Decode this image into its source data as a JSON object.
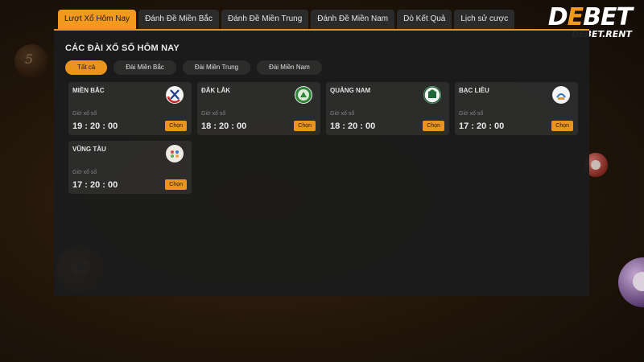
{
  "tabs": [
    {
      "label": "Lượt Xổ Hôm Nay",
      "active": true
    },
    {
      "label": "Đánh Đề Miền Bắc",
      "active": false
    },
    {
      "label": "Đánh Đề Miền Trung",
      "active": false
    },
    {
      "label": "Đánh Đề Miền Nam",
      "active": false
    },
    {
      "label": "Dò Kết Quả",
      "active": false
    },
    {
      "label": "Lịch sử cược",
      "active": false
    }
  ],
  "brand": {
    "logo_text": "DEBET",
    "site": "DEBET.RENT",
    "accent_color": "#f39a1e"
  },
  "panel": {
    "title": "CÁC ĐÀI XỔ SỐ HÔM NAY",
    "filters": [
      {
        "label": "Tất cả",
        "active": true
      },
      {
        "label": "Đài Miền Bắc",
        "active": false
      },
      {
        "label": "Đài Miền Trung",
        "active": false
      },
      {
        "label": "Đài Miền Nam",
        "active": false
      }
    ],
    "stations": [
      {
        "name": "MIỀN BẮC",
        "time_label": "Giờ xổ số",
        "time": "19 : 20 : 00",
        "button": "Chọn",
        "icon": "mien-bac-logo-icon"
      },
      {
        "name": "ĐẮK LẮK",
        "time_label": "Giờ xổ số",
        "time": "18 : 20 : 00",
        "button": "Chọn",
        "icon": "dak-lak-logo-icon"
      },
      {
        "name": "QUẢNG NAM",
        "time_label": "Giờ xổ số",
        "time": "18 : 20 : 00",
        "button": "Chọn",
        "icon": "quang-nam-logo-icon"
      },
      {
        "name": "BẠC LIÊU",
        "time_label": "Giờ xổ số",
        "time": "17 : 20 : 00",
        "button": "Chọn",
        "icon": "bac-lieu-logo-icon"
      },
      {
        "name": "VŨNG TÀU",
        "time_label": "Giờ xổ số",
        "time": "17 : 20 : 00",
        "button": "Chọn",
        "icon": "vung-tau-logo-icon"
      }
    ]
  }
}
